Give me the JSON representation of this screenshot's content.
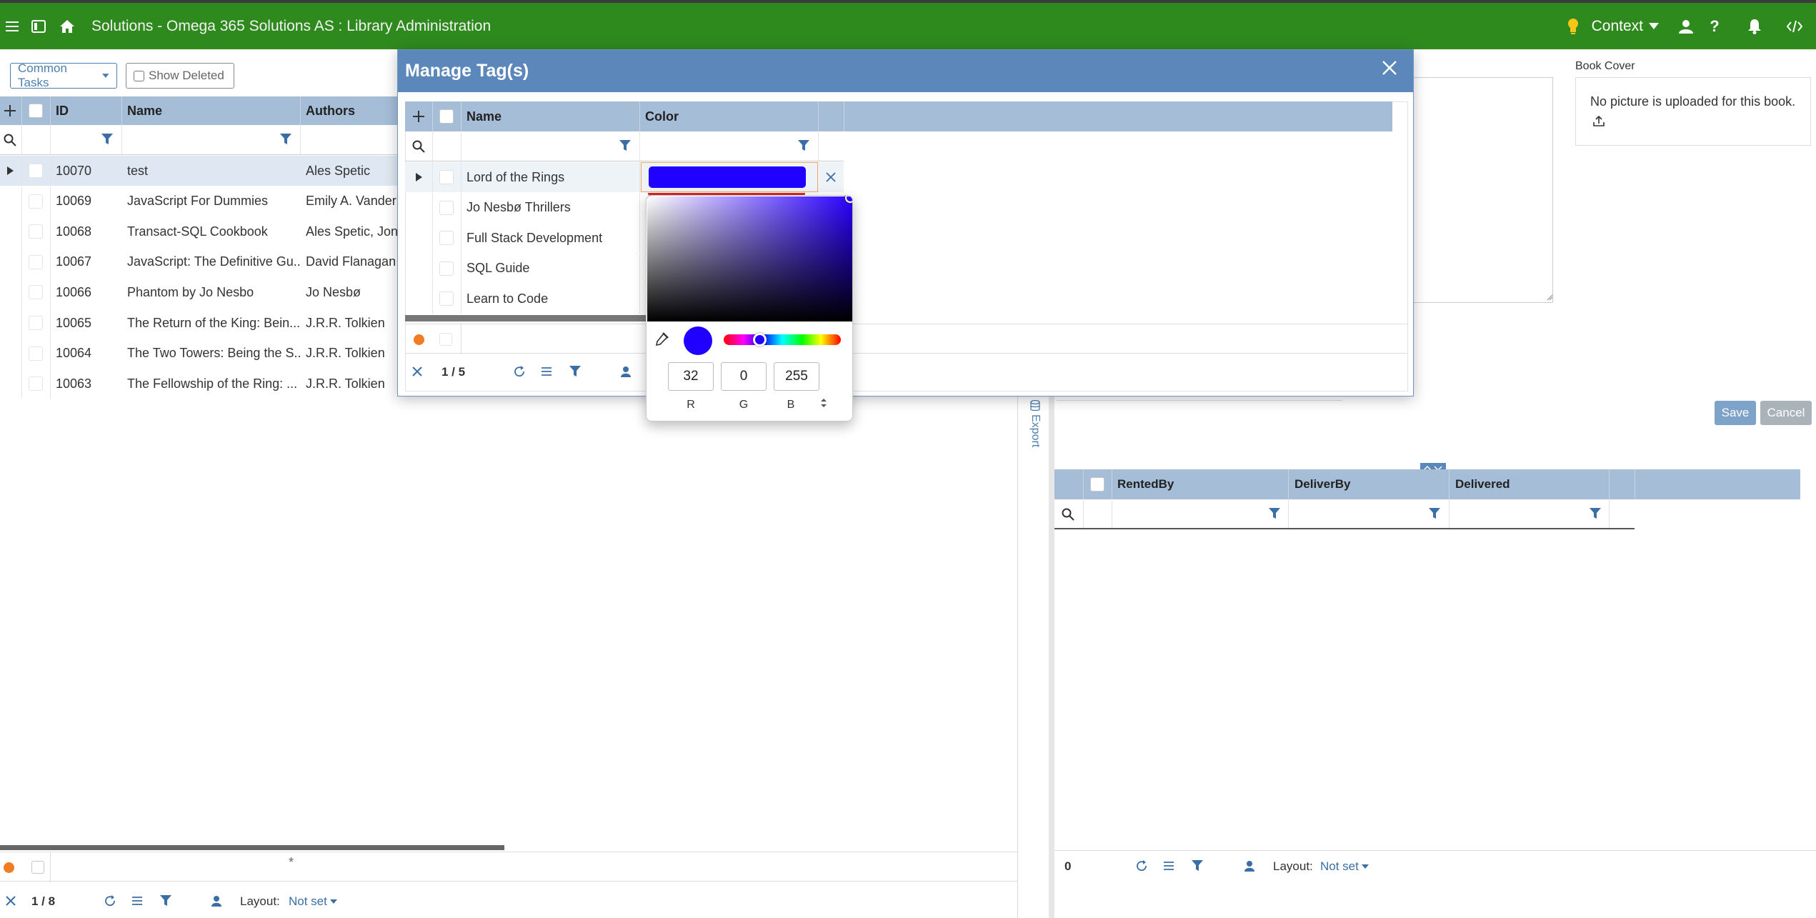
{
  "app": {
    "breadcrumb": "Solutions - Omega 365 Solutions AS : Library Administration",
    "context_label": "Context"
  },
  "toolbar": {
    "common_tasks": "Common Tasks",
    "show_deleted": "Show Deleted"
  },
  "books_grid": {
    "columns": [
      "ID",
      "Name",
      "Authors"
    ],
    "rows": [
      {
        "id": "10070",
        "name": "test",
        "authors": "Ales Spetic"
      },
      {
        "id": "10069",
        "name": "JavaScript For Dummies",
        "authors": "Emily A. Vander"
      },
      {
        "id": "10068",
        "name": "Transact-SQL Cookbook",
        "authors": "Ales Spetic, Jona"
      },
      {
        "id": "10067",
        "name": "JavaScript: The Definitive Gu...",
        "authors": "David Flanagan"
      },
      {
        "id": "10066",
        "name": "Phantom by Jo Nesbo",
        "authors": "Jo Nesbø"
      },
      {
        "id": "10065",
        "name": "The Return of the King: Bein...",
        "authors": "J.R.R. Tolkien"
      },
      {
        "id": "10064",
        "name": "The Two Towers: Being the S...",
        "authors": "J.R.R. Tolkien"
      },
      {
        "id": "10063",
        "name": "The Fellowship of the Ring: ...",
        "authors": "J.R.R. Tolkien"
      }
    ],
    "new_row_marker": "*",
    "paging": "1 / 8",
    "layout_label": "Layout:",
    "layout_value": "Not set"
  },
  "modal": {
    "title": "Manage Tag(s)",
    "columns": [
      "Name",
      "Color"
    ],
    "rows": [
      {
        "name": "Lord of the Rings",
        "color": "#2000ff"
      },
      {
        "name": "Jo Nesbø Thrillers",
        "color": "#d9262a"
      },
      {
        "name": "Full Stack Development",
        "color": ""
      },
      {
        "name": "SQL Guide",
        "color": ""
      },
      {
        "name": "Learn to Code",
        "color": ""
      }
    ],
    "paging": "1 / 5"
  },
  "color_picker": {
    "r": "32",
    "g": "0",
    "b": "255",
    "r_label": "R",
    "g_label": "G",
    "b_label": "B",
    "current_color": "#2000ff"
  },
  "detail_panel": {
    "book_cover_label": "Book Cover",
    "no_picture_text": "No picture is uploaded for this book.",
    "save_label": "Save",
    "cancel_label": "Cancel",
    "export_label": "Export"
  },
  "rentals_grid": {
    "columns": [
      "RentedBy",
      "DeliverBy",
      "Delivered"
    ],
    "count": "0",
    "layout_label": "Layout:",
    "layout_value": "Not set"
  },
  "colors": {
    "topbar": "#2f8a1e",
    "modal_header": "#5b87ba",
    "grid_header": "#a5bdd7",
    "accent_blue": "#4a7fb0",
    "status_orange": "#f07c24"
  }
}
